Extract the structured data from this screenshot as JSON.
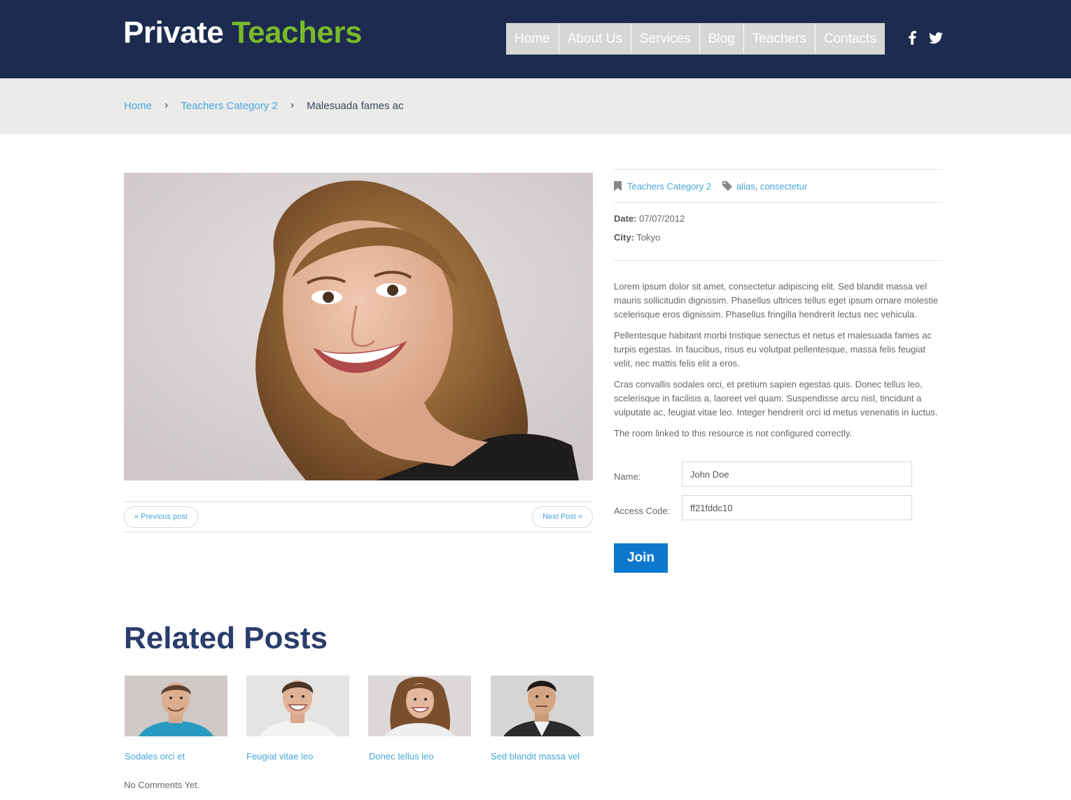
{
  "header": {
    "logo_part1": "Private",
    "logo_part2": "Teachers",
    "nav": [
      "Home",
      "About Us",
      "Services",
      "Blog",
      "Teachers",
      "Contacts"
    ],
    "social": [
      "facebook-icon",
      "twitter-icon"
    ]
  },
  "breadcrumb": {
    "home": "Home",
    "category": "Teachers Category 2",
    "current": "Malesuada fames ac",
    "separator": "›"
  },
  "post_nav": {
    "prev": "« Previous post",
    "next": "Next Post »"
  },
  "meta": {
    "category": "Teachers Category 2",
    "tag1": "alias",
    "tag_sep": ",",
    "tag2": "consectetur",
    "date_label": "Date:",
    "date_value": "07/07/2012",
    "city_label": "City:",
    "city_value": "Tokyo"
  },
  "description": {
    "p1": "Lorem ipsum dolor sit amet, consectetur adipiscing elit. Sed blandit massa vel mauris sollicitudin dignissim. Phasellus ultrices tellus eget ipsum ornare molestie scelerisque eros dignissim. Phasellus fringilla hendrerit lectus nec vehicula.",
    "p2": "Pellentesque habitant morbi tristique senectus et netus et malesuada fames ac turpis egestas. In faucibus, risus eu volutpat pellentesque, massa felis feugiat velit, nec mattis felis elit a eros.",
    "p3": "Cras convallis sodales orci, et pretium sapien egestas quis. Donec tellus leo, scelerisque in facilisis a, laoreet vel quam. Suspendisse arcu nisl, tincidunt a vulputate ac, feugiat vitae leo. Integer hendrerit orci id metus venenatis in luctus.",
    "p4": "The room linked to this resource is not configured correctly."
  },
  "form": {
    "name_label": "Name:",
    "name_value": "John Doe",
    "code_label": "Access Code:",
    "code_value": "ff21fddc10",
    "join_label": "Join"
  },
  "related": {
    "title": "Related Posts",
    "items": [
      "Sodales orci et",
      "Feugiat vitae leo",
      "Donec tellus leo",
      "Sed blandit massa vel"
    ]
  },
  "comments": "No Comments Yet.",
  "colors": {
    "header_bg": "#1c2b4f",
    "brand_green": "#7ab929",
    "link_blue": "#46a7d9",
    "button_blue": "#0b78cd",
    "heading_navy": "#2a3c6b"
  }
}
